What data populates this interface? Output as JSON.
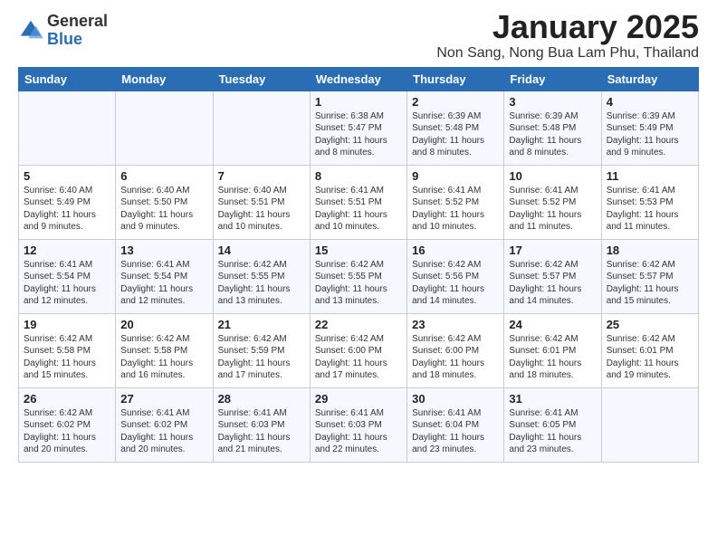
{
  "header": {
    "logo_general": "General",
    "logo_blue": "Blue",
    "month_title": "January 2025",
    "location": "Non Sang, Nong Bua Lam Phu, Thailand"
  },
  "weekdays": [
    "Sunday",
    "Monday",
    "Tuesday",
    "Wednesday",
    "Thursday",
    "Friday",
    "Saturday"
  ],
  "weeks": [
    [
      {
        "day": "",
        "sunrise": "",
        "sunset": "",
        "daylight": ""
      },
      {
        "day": "",
        "sunrise": "",
        "sunset": "",
        "daylight": ""
      },
      {
        "day": "",
        "sunrise": "",
        "sunset": "",
        "daylight": ""
      },
      {
        "day": "1",
        "sunrise": "Sunrise: 6:38 AM",
        "sunset": "Sunset: 5:47 PM",
        "daylight": "Daylight: 11 hours and 8 minutes."
      },
      {
        "day": "2",
        "sunrise": "Sunrise: 6:39 AM",
        "sunset": "Sunset: 5:48 PM",
        "daylight": "Daylight: 11 hours and 8 minutes."
      },
      {
        "day": "3",
        "sunrise": "Sunrise: 6:39 AM",
        "sunset": "Sunset: 5:48 PM",
        "daylight": "Daylight: 11 hours and 8 minutes."
      },
      {
        "day": "4",
        "sunrise": "Sunrise: 6:39 AM",
        "sunset": "Sunset: 5:49 PM",
        "daylight": "Daylight: 11 hours and 9 minutes."
      }
    ],
    [
      {
        "day": "5",
        "sunrise": "Sunrise: 6:40 AM",
        "sunset": "Sunset: 5:49 PM",
        "daylight": "Daylight: 11 hours and 9 minutes."
      },
      {
        "day": "6",
        "sunrise": "Sunrise: 6:40 AM",
        "sunset": "Sunset: 5:50 PM",
        "daylight": "Daylight: 11 hours and 9 minutes."
      },
      {
        "day": "7",
        "sunrise": "Sunrise: 6:40 AM",
        "sunset": "Sunset: 5:51 PM",
        "daylight": "Daylight: 11 hours and 10 minutes."
      },
      {
        "day": "8",
        "sunrise": "Sunrise: 6:41 AM",
        "sunset": "Sunset: 5:51 PM",
        "daylight": "Daylight: 11 hours and 10 minutes."
      },
      {
        "day": "9",
        "sunrise": "Sunrise: 6:41 AM",
        "sunset": "Sunset: 5:52 PM",
        "daylight": "Daylight: 11 hours and 10 minutes."
      },
      {
        "day": "10",
        "sunrise": "Sunrise: 6:41 AM",
        "sunset": "Sunset: 5:52 PM",
        "daylight": "Daylight: 11 hours and 11 minutes."
      },
      {
        "day": "11",
        "sunrise": "Sunrise: 6:41 AM",
        "sunset": "Sunset: 5:53 PM",
        "daylight": "Daylight: 11 hours and 11 minutes."
      }
    ],
    [
      {
        "day": "12",
        "sunrise": "Sunrise: 6:41 AM",
        "sunset": "Sunset: 5:54 PM",
        "daylight": "Daylight: 11 hours and 12 minutes."
      },
      {
        "day": "13",
        "sunrise": "Sunrise: 6:41 AM",
        "sunset": "Sunset: 5:54 PM",
        "daylight": "Daylight: 11 hours and 12 minutes."
      },
      {
        "day": "14",
        "sunrise": "Sunrise: 6:42 AM",
        "sunset": "Sunset: 5:55 PM",
        "daylight": "Daylight: 11 hours and 13 minutes."
      },
      {
        "day": "15",
        "sunrise": "Sunrise: 6:42 AM",
        "sunset": "Sunset: 5:55 PM",
        "daylight": "Daylight: 11 hours and 13 minutes."
      },
      {
        "day": "16",
        "sunrise": "Sunrise: 6:42 AM",
        "sunset": "Sunset: 5:56 PM",
        "daylight": "Daylight: 11 hours and 14 minutes."
      },
      {
        "day": "17",
        "sunrise": "Sunrise: 6:42 AM",
        "sunset": "Sunset: 5:57 PM",
        "daylight": "Daylight: 11 hours and 14 minutes."
      },
      {
        "day": "18",
        "sunrise": "Sunrise: 6:42 AM",
        "sunset": "Sunset: 5:57 PM",
        "daylight": "Daylight: 11 hours and 15 minutes."
      }
    ],
    [
      {
        "day": "19",
        "sunrise": "Sunrise: 6:42 AM",
        "sunset": "Sunset: 5:58 PM",
        "daylight": "Daylight: 11 hours and 15 minutes."
      },
      {
        "day": "20",
        "sunrise": "Sunrise: 6:42 AM",
        "sunset": "Sunset: 5:58 PM",
        "daylight": "Daylight: 11 hours and 16 minutes."
      },
      {
        "day": "21",
        "sunrise": "Sunrise: 6:42 AM",
        "sunset": "Sunset: 5:59 PM",
        "daylight": "Daylight: 11 hours and 17 minutes."
      },
      {
        "day": "22",
        "sunrise": "Sunrise: 6:42 AM",
        "sunset": "Sunset: 6:00 PM",
        "daylight": "Daylight: 11 hours and 17 minutes."
      },
      {
        "day": "23",
        "sunrise": "Sunrise: 6:42 AM",
        "sunset": "Sunset: 6:00 PM",
        "daylight": "Daylight: 11 hours and 18 minutes."
      },
      {
        "day": "24",
        "sunrise": "Sunrise: 6:42 AM",
        "sunset": "Sunset: 6:01 PM",
        "daylight": "Daylight: 11 hours and 18 minutes."
      },
      {
        "day": "25",
        "sunrise": "Sunrise: 6:42 AM",
        "sunset": "Sunset: 6:01 PM",
        "daylight": "Daylight: 11 hours and 19 minutes."
      }
    ],
    [
      {
        "day": "26",
        "sunrise": "Sunrise: 6:42 AM",
        "sunset": "Sunset: 6:02 PM",
        "daylight": "Daylight: 11 hours and 20 minutes."
      },
      {
        "day": "27",
        "sunrise": "Sunrise: 6:41 AM",
        "sunset": "Sunset: 6:02 PM",
        "daylight": "Daylight: 11 hours and 20 minutes."
      },
      {
        "day": "28",
        "sunrise": "Sunrise: 6:41 AM",
        "sunset": "Sunset: 6:03 PM",
        "daylight": "Daylight: 11 hours and 21 minutes."
      },
      {
        "day": "29",
        "sunrise": "Sunrise: 6:41 AM",
        "sunset": "Sunset: 6:03 PM",
        "daylight": "Daylight: 11 hours and 22 minutes."
      },
      {
        "day": "30",
        "sunrise": "Sunrise: 6:41 AM",
        "sunset": "Sunset: 6:04 PM",
        "daylight": "Daylight: 11 hours and 23 minutes."
      },
      {
        "day": "31",
        "sunrise": "Sunrise: 6:41 AM",
        "sunset": "Sunset: 6:05 PM",
        "daylight": "Daylight: 11 hours and 23 minutes."
      },
      {
        "day": "",
        "sunrise": "",
        "sunset": "",
        "daylight": ""
      }
    ]
  ]
}
